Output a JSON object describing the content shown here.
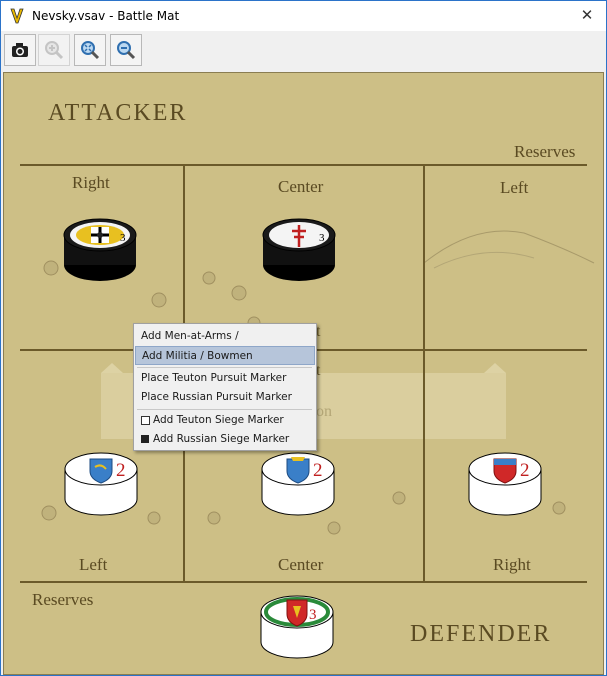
{
  "window": {
    "title": "Nevsky.vsav - Battle Mat",
    "close_glyph": "✕"
  },
  "toolbar": {
    "buttons": [
      {
        "name": "camera-icon"
      },
      {
        "name": "zoom-in-icon"
      },
      {
        "name": "zoom-fit-icon"
      },
      {
        "name": "zoom-out-icon"
      }
    ]
  },
  "mat": {
    "attacker": "ATTACKER",
    "defender": "DEFENDER",
    "top_reserves": "Reserves",
    "bottom_reserves": "Reserves",
    "top_zones": {
      "right": "Right",
      "center": "Center",
      "left": "Left"
    },
    "bottom_zones": {
      "left": "Left",
      "center": "Center",
      "right": "Right"
    },
    "ghost": {
      "t1": "t",
      "t2": "t",
      "pursuit": "on"
    }
  },
  "pieces": {
    "teuton_right": {
      "value": "3"
    },
    "teuton_center": {
      "value": "3"
    },
    "rus_left": {
      "value": "2"
    },
    "rus_center": {
      "value": "2"
    },
    "rus_right": {
      "value": "2"
    },
    "rus_reserve": {
      "value": "3"
    }
  },
  "context_menu": {
    "items": [
      "Add Men-at-Arms / Crossbowmen",
      "Add Militia / Bowmen",
      "Place Teuton Pursuit Marker",
      "Place Russian Pursuit Marker",
      "Add Teuton Siege Marker",
      "Add Russian Siege Marker"
    ],
    "highlighted_index": 1
  },
  "colors": {
    "mat": "#cdbf86",
    "ink": "#5a4a22",
    "highlight": "#b6c5da"
  }
}
